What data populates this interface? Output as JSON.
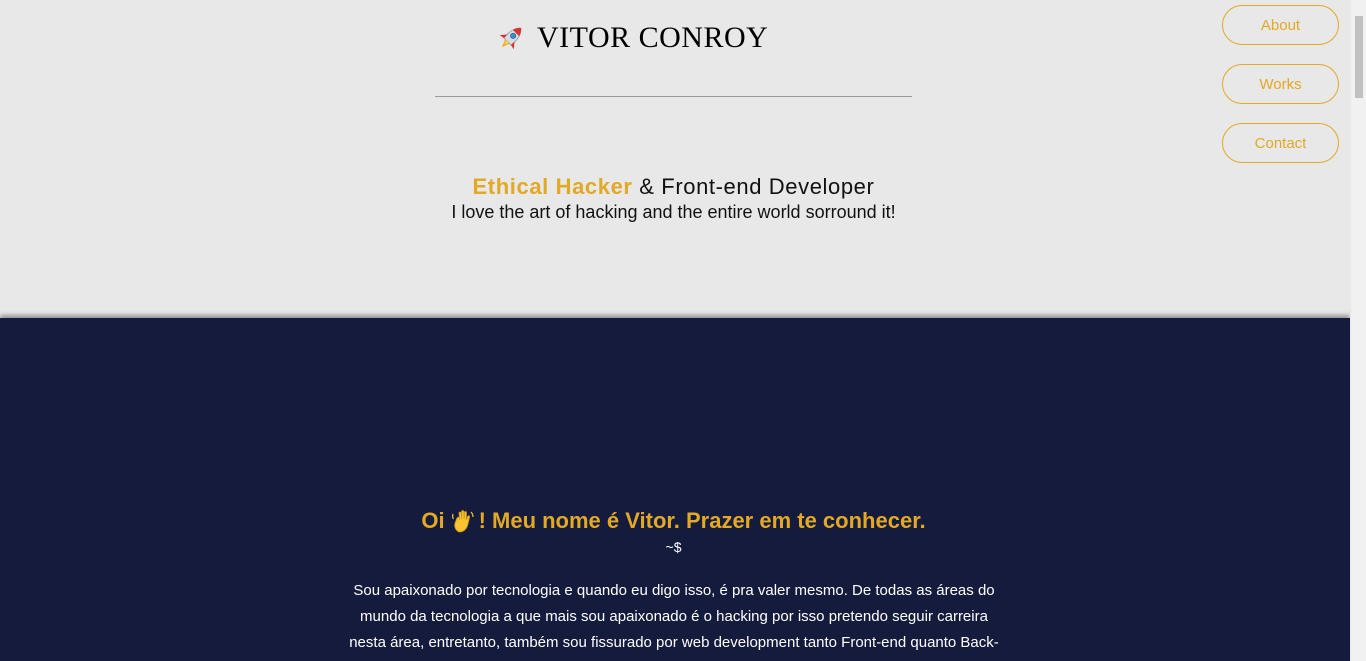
{
  "header": {
    "brand_name": "VITOR CONROY",
    "brand_icon": "rocket-icon"
  },
  "nav": {
    "items": [
      {
        "label": "About"
      },
      {
        "label": "Works"
      },
      {
        "label": "Contact"
      }
    ]
  },
  "hero": {
    "tagline_accent": "Ethical Hacker",
    "tagline_rest": " & Front-end Developer",
    "subtagline": "I love the art of hacking and the entire world sorround it!"
  },
  "about": {
    "title_before": "Oi",
    "title_icon": "waving-hand-icon",
    "title_after": "! Meu nome é Vitor. Prazer em te conhecer.",
    "prompt": "~$",
    "text": "Sou apaixonado por tecnologia e quando eu digo isso, é pra valer mesmo. De todas as áreas do mundo da tecnologia a que mais sou apaixonado é o hacking por isso pretendo seguir carreira nesta área, entretanto, também sou fissurado por web development tanto Front-end quanto Back-end"
  },
  "colors": {
    "accent": "#e3a824",
    "hero_bg": "#e8e8e8",
    "about_bg": "#151b3d"
  }
}
